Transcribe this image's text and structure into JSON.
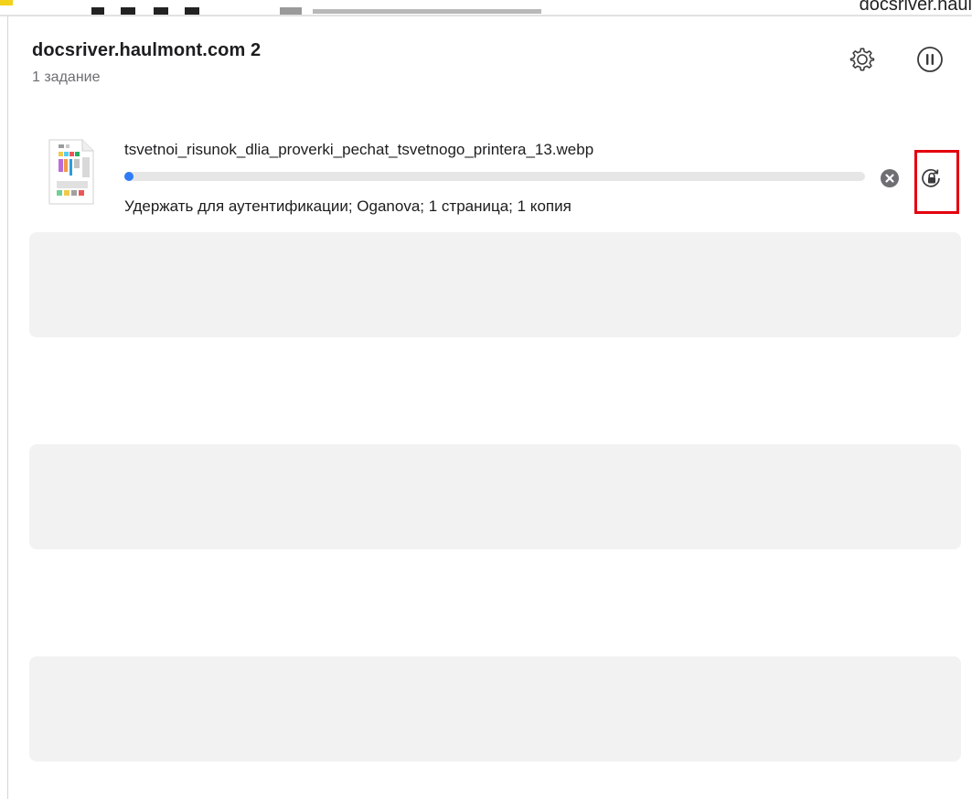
{
  "window": {
    "title": "docsriver.haulmont.com 2",
    "subtitle": "1 задание"
  },
  "top_strip": {
    "host_text": "docsriver.haul"
  },
  "toolbar": {
    "settings_icon": "gear-icon",
    "pause_icon": "pause-icon"
  },
  "job": {
    "filename": "tsvetnoi_risunok_dlia_proverki_pechat_tsvetnogo_printera_13.webp",
    "status": "Удержать для аутентификации; Oganova; 1 страница; 1 копия",
    "progress_percent": 1,
    "cancel_icon": "close-circle-icon",
    "resume_icon": "lock-resume-icon"
  },
  "colors": {
    "accent": "#2f7cf6",
    "highlight": "#e3000f",
    "placeholder": "#f2f2f2"
  }
}
